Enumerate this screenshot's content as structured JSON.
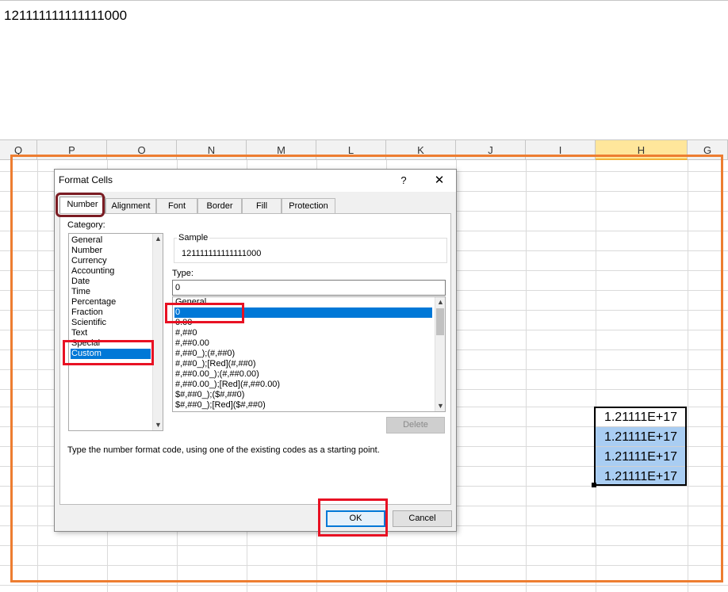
{
  "formula_bar": {
    "content": "121111111111111000"
  },
  "columns": [
    {
      "label": "Q",
      "selected": false
    },
    {
      "label": "P",
      "selected": false
    },
    {
      "label": "O",
      "selected": false
    },
    {
      "label": "N",
      "selected": false
    },
    {
      "label": "M",
      "selected": false
    },
    {
      "label": "L",
      "selected": false
    },
    {
      "label": "K",
      "selected": false
    },
    {
      "label": "J",
      "selected": false
    },
    {
      "label": "I",
      "selected": false
    },
    {
      "label": "H",
      "selected": true
    },
    {
      "label": "G",
      "selected": false
    }
  ],
  "cells": [
    "1.21111E+17",
    "1.21111E+17",
    "1.21111E+17",
    "1.21111E+17"
  ],
  "dialog": {
    "title": "Format Cells",
    "help_label": "?",
    "close_label": "✕",
    "tabs": [
      "Number",
      "Alignment",
      "Font",
      "Border",
      "Fill",
      "Protection"
    ],
    "active_tab": "Number",
    "category_label": "Category:",
    "categories": [
      "General",
      "Number",
      "Currency",
      "Accounting",
      "Date",
      "Time",
      "Percentage",
      "Fraction",
      "Scientific",
      "Text",
      "Special",
      "Custom"
    ],
    "selected_category": "Custom",
    "sample_caption": "Sample",
    "sample_value": "121111111111111000",
    "type_label": "Type:",
    "type_value": "0",
    "formats": [
      "General",
      "0",
      "0.00",
      "#,##0",
      "#,##0.00",
      "#,##0_);(#,##0)",
      "#,##0_);[Red](#,##0)",
      "#,##0.00_);(#,##0.00)",
      "#,##0.00_);[Red](#,##0.00)",
      "$#,##0_);($#,##0)",
      "$#,##0_);[Red]($#,##0)"
    ],
    "selected_format": "0",
    "delete_label": "Delete",
    "hint": "Type the number format code, using one of the existing codes as a starting point.",
    "ok_label": "OK",
    "cancel_label": "Cancel"
  },
  "colors": {
    "accent": "#0078d7",
    "highlight_red": "#e81123",
    "highlight_maroon": "#7b1c23",
    "frame_orange": "#ed7d31",
    "cell_selected": "#a9cdf2",
    "column_selected": "#ffe69b"
  }
}
